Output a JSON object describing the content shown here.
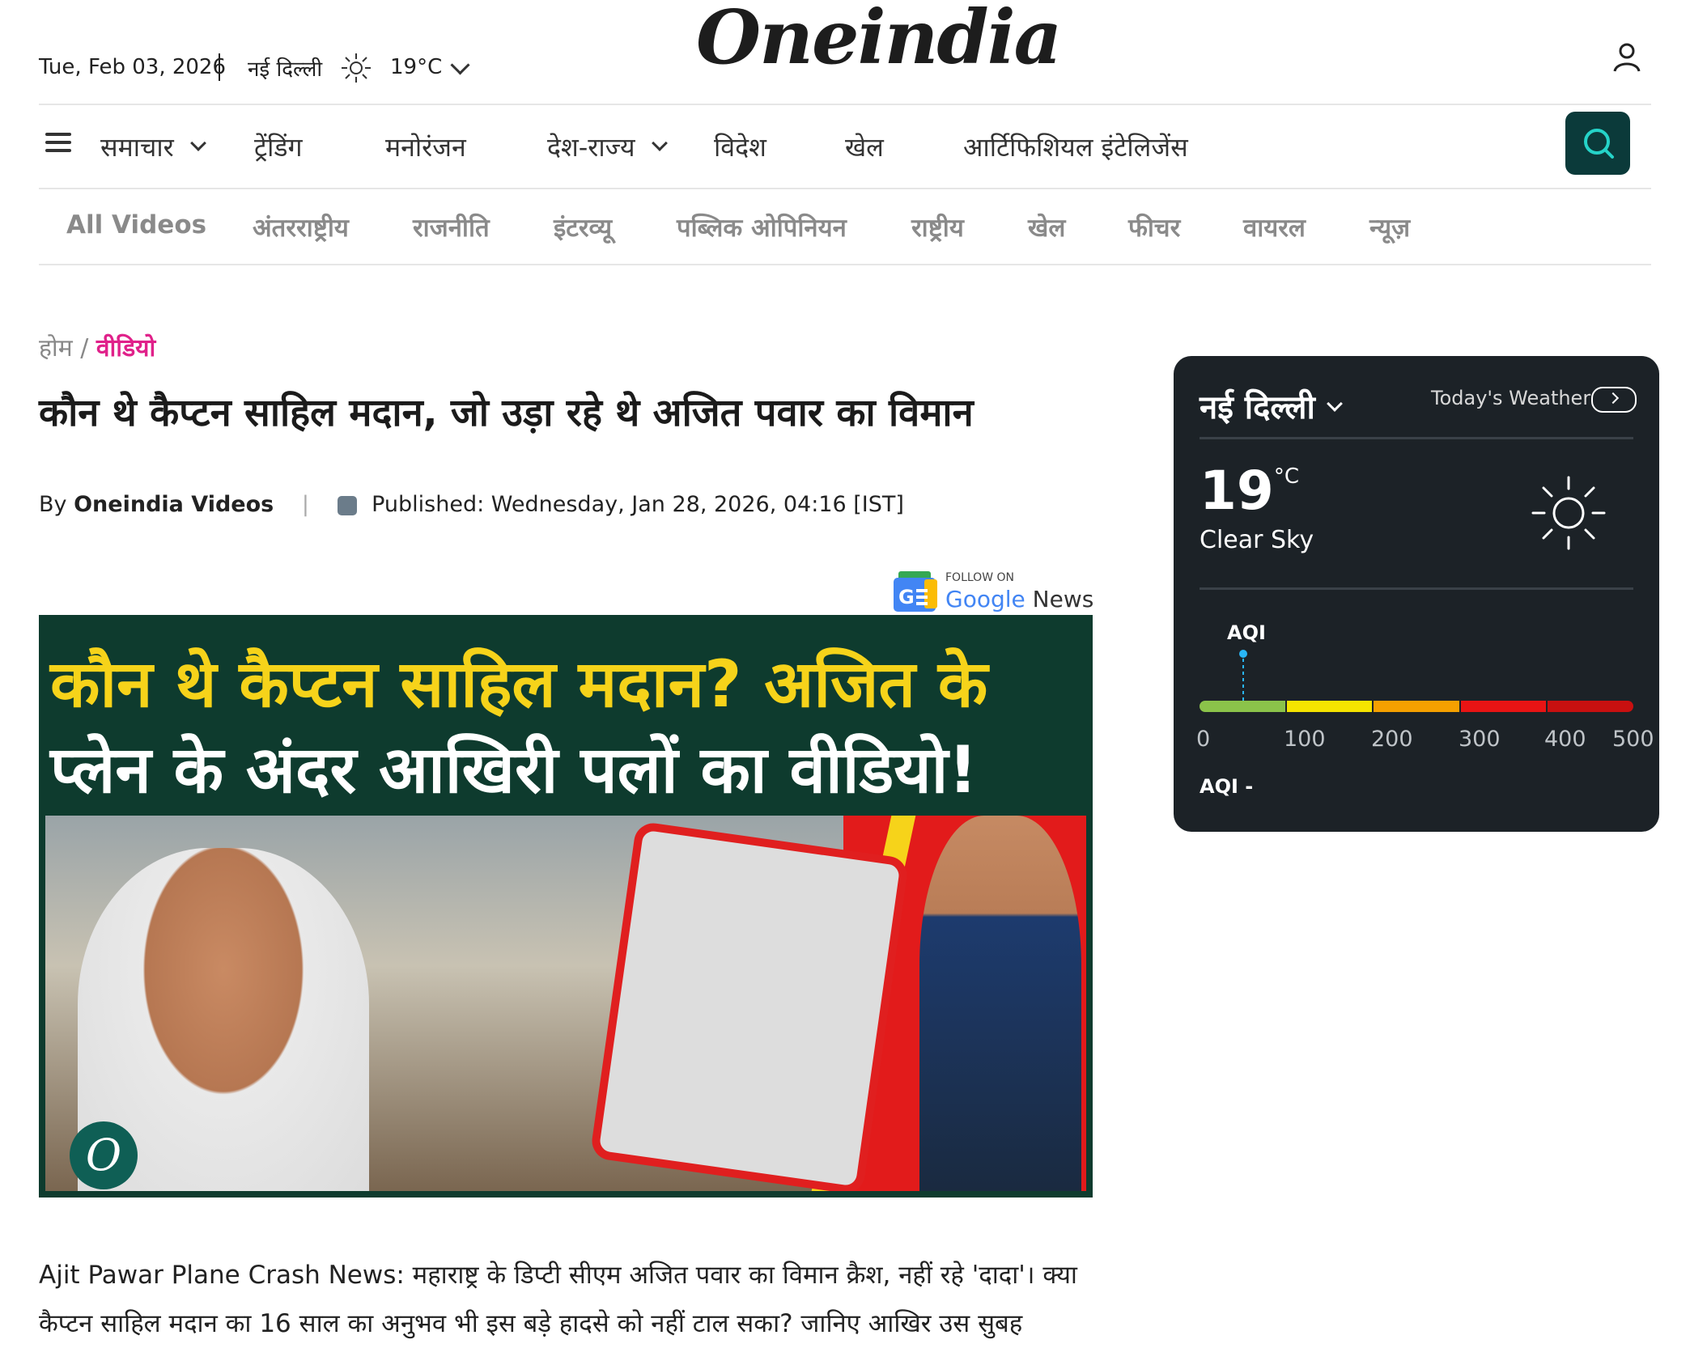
{
  "header": {
    "date": "Tue, Feb 03, 2026",
    "city": "नई दिल्ली",
    "temperature": "19°C",
    "logo_text": "Oneindia"
  },
  "main_nav": {
    "items": [
      "समाचार",
      "ट्रेंडिंग",
      "मनोरंजन",
      "देश-राज्य",
      "विदेश",
      "खेल",
      "आर्टिफिशियल इंटेलिजेंस"
    ]
  },
  "sub_nav": {
    "items": [
      "All Videos",
      "अंतरराष्ट्रीय",
      "राजनीति",
      "इंटरव्यू",
      "पब्लिक ओपिनियन",
      "राष्ट्रीय",
      "खेल",
      "फीचर",
      "वायरल",
      "न्यूज़"
    ]
  },
  "breadcrumb": {
    "home": "होम",
    "separator": "/",
    "current": "वीडियो"
  },
  "article": {
    "title": "कौन थे कैप्टन साहिल मदान, जो उड़ा रहे थे अजित पवार का विमान",
    "by_prefix": "By",
    "author": "Oneindia Videos",
    "published": "Published: Wednesday, Jan 28, 2026, 04:16 [IST]",
    "follow_on": "FOLLOW ON",
    "google": "Google",
    "news": "News",
    "thumbnail_line1": "कौन थे कैप्टन साहिल मदान? अजित के",
    "thumbnail_line2": "प्लेन के अंदर आखिरी पलों का वीडियो!",
    "thumbnail_logo": "O",
    "description": "Ajit Pawar Plane Crash News: महाराष्ट्र के डिप्टी सीएम अजित पवार का विमान क्रैश, नहीं रहे 'दादा'। क्या कैप्टन साहिल मदान का 16 साल का अनुभव भी इस बड़े हादसे को नहीं टाल सका? जानिए आखिर उस सुबह"
  },
  "weather": {
    "city": "नई दिल्ली",
    "label": "Today's Weather",
    "temp": "19",
    "unit": "°C",
    "condition": "Clear Sky",
    "aqi_label": "AQI",
    "aqi_scale": [
      "0",
      "100",
      "200",
      "300",
      "400",
      "500"
    ],
    "aqi_footer": "AQI -",
    "aqi_colors": [
      "#8bc34a",
      "#f5e400",
      "#f5a000",
      "#e81414",
      "#c81010"
    ]
  },
  "colors": {
    "accent_pink": "#e0218a",
    "search_bg": "#0b3a3a",
    "thumbnail_yellow": "#f6d31a"
  }
}
